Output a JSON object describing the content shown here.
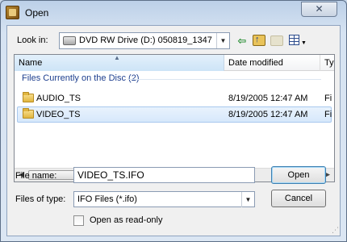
{
  "window": {
    "title": "Open",
    "close_label": "✕"
  },
  "toolbar": {
    "look_in_label": "Look in:",
    "look_in_value": "DVD RW Drive (D:) 050819_1347",
    "icons": [
      "back-icon",
      "up-folder-icon",
      "new-folder-icon",
      "views-menu-icon"
    ]
  },
  "file_list": {
    "columns": [
      {
        "label": "Name"
      },
      {
        "label": "Date modified"
      },
      {
        "label": "Ty"
      }
    ],
    "group_header": "Files Currently on the Disc (2)",
    "rows": [
      {
        "name": "AUDIO_TS",
        "date": "8/19/2005 12:47 AM",
        "type": "Fi",
        "selected": false
      },
      {
        "name": "VIDEO_TS",
        "date": "8/19/2005 12:47 AM",
        "type": "Fi",
        "selected": true
      }
    ],
    "scroll_left": "◀",
    "scroll_right": "▶",
    "scroll_grip": "|||"
  },
  "form": {
    "file_name_label": "File name:",
    "file_name_value": "VIDEO_TS.IFO",
    "file_type_label": "Files of type:",
    "file_type_value": "IFO Files (*.ifo)",
    "read_only_label": "Open as read-only",
    "open_button": "Open",
    "cancel_button": "Cancel"
  },
  "colors": {
    "group_header": "#1e3f8f",
    "selection": "#d7e8fb",
    "title_bar": "#bcd0e8"
  }
}
